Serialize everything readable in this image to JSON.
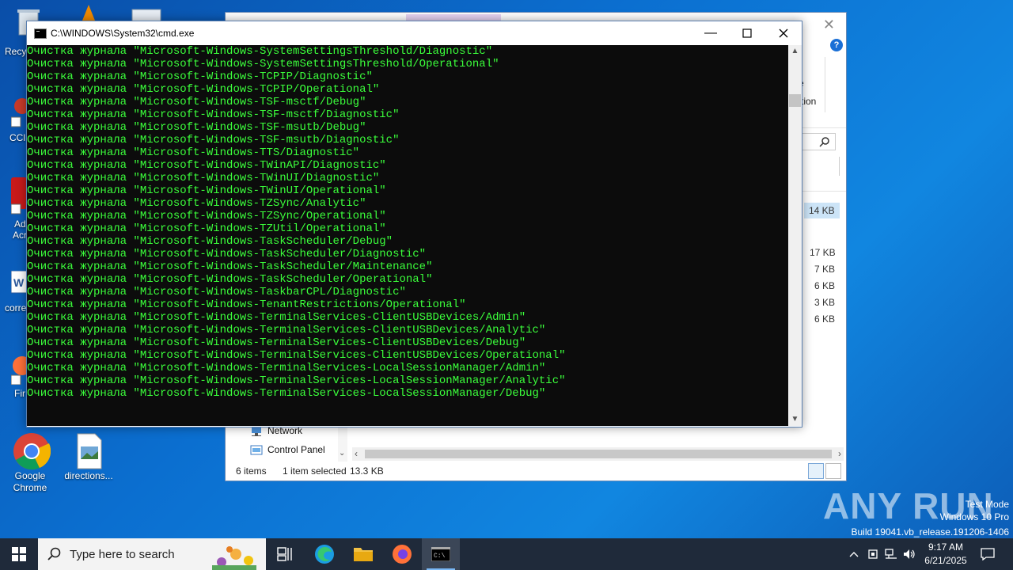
{
  "desktop": {
    "icons": [
      {
        "label": "Google Chrome"
      },
      {
        "label": "directions..."
      }
    ],
    "partial_labels": [
      "Recy",
      "CCl",
      "Ad",
      "Acr",
      "corre",
      "Fir"
    ]
  },
  "explorer": {
    "partial_text": "e",
    "partial_text2": "tion",
    "sizes": [
      "14 KB",
      "17 KB",
      "7 KB",
      "6 KB",
      "3 KB",
      "6 KB"
    ],
    "nav": [
      {
        "label": "Network"
      },
      {
        "label": "Control Panel"
      }
    ],
    "status": {
      "items": "6 items",
      "selected": "1 item selected",
      "size": "13.3 KB"
    }
  },
  "cmd": {
    "title": "C:\\WINDOWS\\System32\\cmd.exe",
    "lines": [
      "Очистка журнала \"Microsoft-Windows-SystemSettingsThreshold/Diagnostic\"",
      "Очистка журнала \"Microsoft-Windows-SystemSettingsThreshold/Operational\"",
      "Очистка журнала \"Microsoft-Windows-TCPIP/Diagnostic\"",
      "Очистка журнала \"Microsoft-Windows-TCPIP/Operational\"",
      "Очистка журнала \"Microsoft-Windows-TSF-msctf/Debug\"",
      "Очистка журнала \"Microsoft-Windows-TSF-msctf/Diagnostic\"",
      "Очистка журнала \"Microsoft-Windows-TSF-msutb/Debug\"",
      "Очистка журнала \"Microsoft-Windows-TSF-msutb/Diagnostic\"",
      "Очистка журнала \"Microsoft-Windows-TTS/Diagnostic\"",
      "Очистка журнала \"Microsoft-Windows-TWinAPI/Diagnostic\"",
      "Очистка журнала \"Microsoft-Windows-TWinUI/Diagnostic\"",
      "Очистка журнала \"Microsoft-Windows-TWinUI/Operational\"",
      "Очистка журнала \"Microsoft-Windows-TZSync/Analytic\"",
      "Очистка журнала \"Microsoft-Windows-TZSync/Operational\"",
      "Очистка журнала \"Microsoft-Windows-TZUtil/Operational\"",
      "Очистка журнала \"Microsoft-Windows-TaskScheduler/Debug\"",
      "Очистка журнала \"Microsoft-Windows-TaskScheduler/Diagnostic\"",
      "Очистка журнала \"Microsoft-Windows-TaskScheduler/Maintenance\"",
      "Очистка журнала \"Microsoft-Windows-TaskScheduler/Operational\"",
      "Очистка журнала \"Microsoft-Windows-TaskbarCPL/Diagnostic\"",
      "Очистка журнала \"Microsoft-Windows-TenantRestrictions/Operational\"",
      "Очистка журнала \"Microsoft-Windows-TerminalServices-ClientUSBDevices/Admin\"",
      "Очистка журнала \"Microsoft-Windows-TerminalServices-ClientUSBDevices/Analytic\"",
      "Очистка журнала \"Microsoft-Windows-TerminalServices-ClientUSBDevices/Debug\"",
      "Очистка журнала \"Microsoft-Windows-TerminalServices-ClientUSBDevices/Operational\"",
      "Очистка журнала \"Microsoft-Windows-TerminalServices-LocalSessionManager/Admin\"",
      "Очистка журнала \"Microsoft-Windows-TerminalServices-LocalSessionManager/Analytic\"",
      "Очистка журнала \"Microsoft-Windows-TerminalServices-LocalSessionManager/Debug\""
    ]
  },
  "taskbar": {
    "search_placeholder": "Type here to search",
    "time": "9:17 AM",
    "date": "6/21/2025"
  },
  "watermark": {
    "brand": "ANY RUN",
    "mode": "Test Mode",
    "edition": "Windows 10 Pro",
    "build": "Build 19041.vb_release.191206-1406"
  },
  "colors": {
    "console_text": "#3bff3b",
    "console_bg": "#0c0c0c"
  }
}
